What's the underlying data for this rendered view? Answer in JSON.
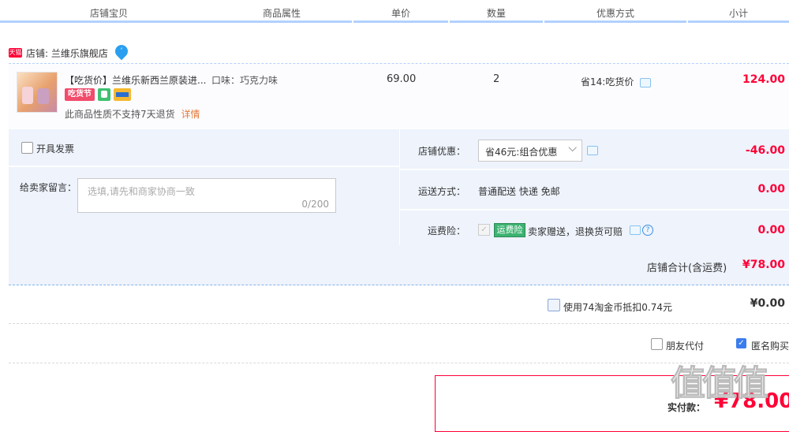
{
  "header": {
    "col_shop_item": "店铺宝贝",
    "col_attr": "商品属性",
    "col_price": "单价",
    "col_qty": "数量",
    "col_discount": "优惠方式",
    "col_subtotal": "小计"
  },
  "shop": {
    "badge": "天猫",
    "name": "店铺: 兰维乐旗舰店"
  },
  "item": {
    "title": "【吃货价】兰维乐新西兰原装进...",
    "attr": "口味：巧克力味",
    "price": "69.00",
    "qty": "2",
    "discount": "省14:吃货价",
    "subtotal": "124.00",
    "badge_eat": "吃货节",
    "note": "此商品性质不支持7天退货",
    "details_link": "详情"
  },
  "invoice": {
    "label": "开具发票"
  },
  "seller_message": {
    "label": "给卖家留言：",
    "placeholder": "选填,请先和商家协商一致",
    "counter": "0/200"
  },
  "shop_discount": {
    "label": "店铺优惠：",
    "selected": "省46元:组合优惠",
    "amount": "-46.00"
  },
  "shipping": {
    "label": "运送方式：",
    "value": "普通配送 快递 免邮",
    "amount": "0.00"
  },
  "insurance": {
    "label": "运费险：",
    "badge": "运费险",
    "value": "卖家赠送，退换货可赔",
    "amount": "0.00"
  },
  "shop_total": {
    "label": "店铺合计(含运费)",
    "amount": "¥78.00"
  },
  "coins": {
    "label": "使用74淘金币抵扣0.74元",
    "amount": "¥0.00"
  },
  "options": {
    "friend_pay": "朋友代付",
    "anonymous": "匿名购买"
  },
  "payment": {
    "label": "实付款：",
    "amount": "¥78.00"
  },
  "watermark": "值",
  "colors": {
    "accent_red": "#ff0036",
    "header_line": "#b2d1ff",
    "panel_bg": "#eef3fc",
    "link_orange": "#e4793a"
  },
  "icons": {
    "tmall": "tmall-logo-icon",
    "wangwang": "wangwang-chat-icon",
    "message": "message-bubble-icon",
    "help": "help-circle-icon",
    "dropdown": "chevron-down-icon"
  }
}
